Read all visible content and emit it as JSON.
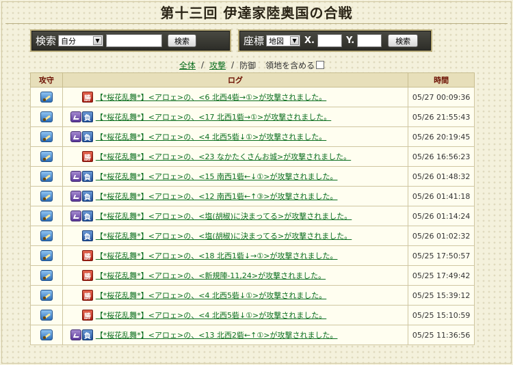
{
  "page_title": "第十三回 伊達家陸奥国の合戦",
  "search_panel": {
    "label": "検索",
    "select_value": "自分",
    "input_value": "",
    "button_label": "検索"
  },
  "coord_panel": {
    "label": "座標",
    "select_value": "地図",
    "x_label": "X.",
    "x_value": "",
    "y_label": "Y.",
    "y_value": "",
    "button_label": "検索"
  },
  "filters": {
    "all": "全体",
    "attack": "攻撃",
    "defense": "防御",
    "include_land": "領地を含める",
    "separator": "/"
  },
  "table": {
    "headers": {
      "type": "攻守",
      "log": "ログ",
      "time": "時間"
    },
    "win_label": "勝",
    "lose_label": "負",
    "rows": [
      {
        "result": "win",
        "purple": false,
        "log": "【*桜花乱舞*】<アロェ>の、<6 北西4砦→①>が攻撃されました。",
        "time": "05/27 00:09:36"
      },
      {
        "result": "lose",
        "purple": true,
        "log": "【*桜花乱舞*】<アロェ>の、<17 北西1砦→①>が攻撃されました。",
        "time": "05/26 21:55:43"
      },
      {
        "result": "lose",
        "purple": true,
        "log": "【*桜花乱舞*】<アロェ>の、<4 北西5砦↓①>が攻撃されました。",
        "time": "05/26 20:19:45"
      },
      {
        "result": "win",
        "purple": false,
        "log": "【*桜花乱舞*】<アロェ>の、<23 なかたくさんお城>が攻撃されました。",
        "time": "05/26 16:56:23"
      },
      {
        "result": "lose",
        "purple": true,
        "log": "【*桜花乱舞*】<アロェ>の、<15 南西1砦←↓①>が攻撃されました。",
        "time": "05/26 01:48:32"
      },
      {
        "result": "lose",
        "purple": true,
        "log": "【*桜花乱舞*】<アロェ>の、<12 南西1砦←↑③>が攻撃されました。",
        "time": "05/26 01:41:18"
      },
      {
        "result": "lose",
        "purple": true,
        "log": "【*桜花乱舞*】<アロェ>の、<塩(胡椒)に決まってる>が攻撃されました。",
        "time": "05/26 01:14:24"
      },
      {
        "result": "lose",
        "purple": false,
        "log": "【*桜花乱舞*】<アロェ>の、<塩(胡椒)に決まってる>が攻撃されました。",
        "time": "05/26 01:02:32"
      },
      {
        "result": "win",
        "purple": false,
        "log": "【*桜花乱舞*】<アロェ>の、<18 北西1砦↓→①>が攻撃されました。",
        "time": "05/25 17:50:57"
      },
      {
        "result": "win",
        "purple": false,
        "log": "【*桜花乱舞*】<アロェ>の、<新規陣-11,24>が攻撃されました。",
        "time": "05/25 17:49:42"
      },
      {
        "result": "win",
        "purple": false,
        "log": "【*桜花乱舞*】<アロェ>の、<4 北西5砦↓①>が攻撃されました。",
        "time": "05/25 15:39:12"
      },
      {
        "result": "win",
        "purple": false,
        "log": "【*桜花乱舞*】<アロェ>の、<4 北西5砦↓①>が攻撃されました。",
        "time": "05/25 15:10:59"
      },
      {
        "result": "lose",
        "purple": true,
        "log": "【*桜花乱舞*】<アロェ>の、<13 北西2砦←↑①>が攻撃されました。",
        "time": "05/25 11:36:56"
      }
    ]
  }
}
